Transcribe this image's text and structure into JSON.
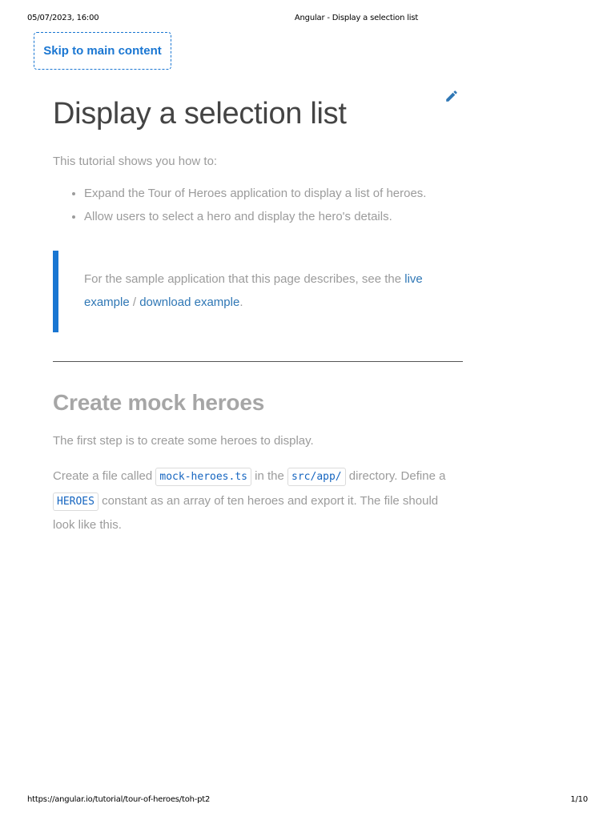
{
  "print_header": {
    "date": "05/07/2023, 16:00",
    "title": "Angular - Display a selection list"
  },
  "print_footer": {
    "url": "https://angular.io/tutorial/tour-of-heroes/toh-pt2",
    "page": "1/10"
  },
  "skip_link": {
    "label": "Skip to main content"
  },
  "edit_icon": {
    "name": "pencil-edit-icon",
    "color": "#2f77b5"
  },
  "page_title": "Display a selection list",
  "intro": "This tutorial shows you how to:",
  "bullets": [
    "Expand the Tour of Heroes application to display a list of heroes.",
    "Allow users to select a hero and display the hero's details."
  ],
  "callout": {
    "text_before": "For the sample application that this page describes, see the ",
    "live_example": "live example",
    "separator": " / ",
    "download_example": "download example",
    "text_after": "."
  },
  "section": {
    "title": "Create mock heroes",
    "step_text": "The first step is to create some heroes to display.",
    "create_text": {
      "part1": "Create a file called ",
      "code1": "mock-heroes.ts",
      "part2": " in the ",
      "code2": "src/app/",
      "part3": " directory. Define a ",
      "code3": "HEROES",
      "part4": " constant as an array of ten heroes and export it. The file should look like this."
    }
  },
  "colors": {
    "accent": "#1976d2",
    "link": "#2f77b5",
    "heading": "#444444",
    "body_text": "#9b9b9b"
  }
}
